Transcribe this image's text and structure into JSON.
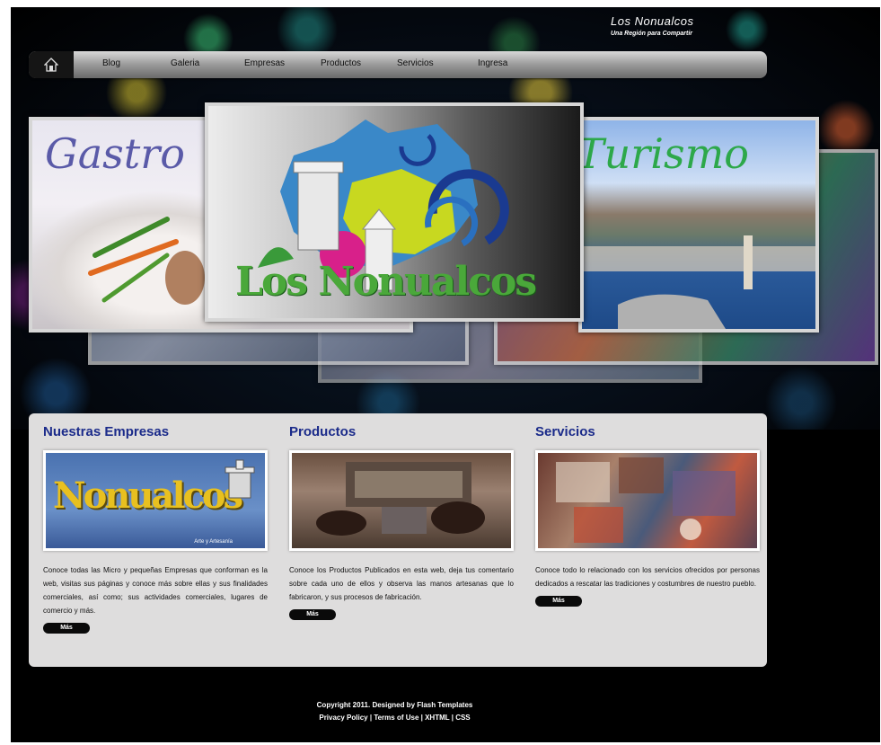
{
  "header": {
    "site_title": "Los Nonualcos",
    "tagline": "Una Región para Compartir"
  },
  "nav": {
    "home_icon": "home-icon",
    "items": [
      "Blog",
      "Galeria",
      "Empresas",
      "Productos",
      "Servicios",
      "Ingresa"
    ]
  },
  "slider": {
    "center_title": "Los Nonualcos",
    "left_label": "Gastro",
    "right_label": "Turismo"
  },
  "sections": [
    {
      "title": "Nuestras Empresas",
      "thumb_text": "Nonualcos",
      "thumb_caption": "Arte y Artesanía",
      "description": "Conoce todas las Micro y pequeñas Empresas que conforman es la web, visitas sus páginas y conoce más sobre ellas y sus finalidades comerciales, así como; sus actividades comerciales, lugares de comercio y más.",
      "button": "Más"
    },
    {
      "title": "Productos",
      "description": "Conoce los Productos Publicados en esta web, deja tus comentario sobre cada uno de ellos y observa las manos artesanas que lo fabricaron, y sus procesos de fabricación.",
      "button": "Más"
    },
    {
      "title": "Servicios",
      "description": "Conoce todo lo relacionado con los servicios ofrecidos por personas dedicados a rescatar las tradiciones y costumbres de nuestro pueblo.",
      "button": "Más"
    }
  ],
  "footer": {
    "copyright": "Copyright 2011. Designed by Flash Templates",
    "links": [
      "Privacy Policy",
      "Terms of Use",
      "XHTML",
      "CSS"
    ]
  },
  "colors": {
    "section_title": "#1b2b8a",
    "background": "#000000",
    "panel": "#dedddd"
  }
}
